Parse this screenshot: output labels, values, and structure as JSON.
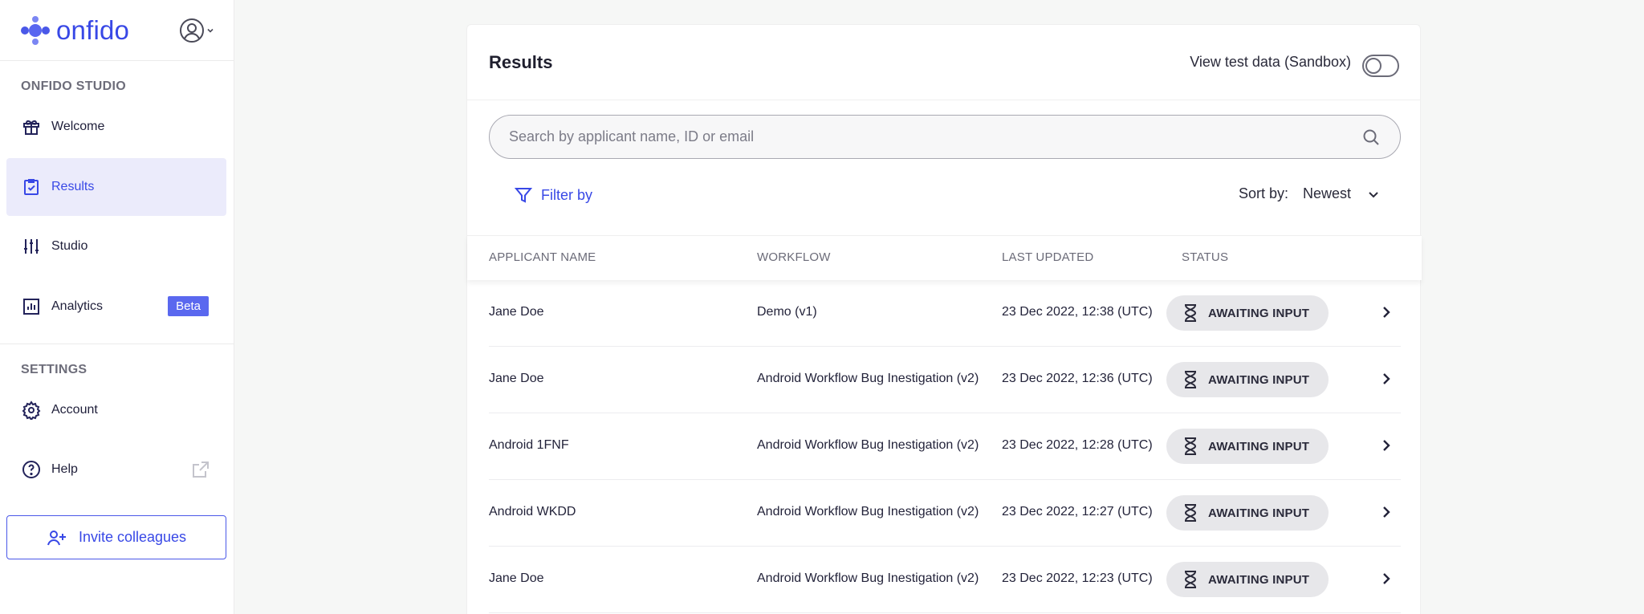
{
  "brand": {
    "name": "onfido"
  },
  "sidebar": {
    "studio_section": "ONFIDO STUDIO",
    "items": [
      {
        "label": "Welcome",
        "icon": "gift-icon"
      },
      {
        "label": "Results",
        "icon": "clipboard-check-icon",
        "active": true
      },
      {
        "label": "Studio",
        "icon": "sliders-icon"
      },
      {
        "label": "Analytics",
        "icon": "bar-chart-icon",
        "badge": "Beta"
      }
    ],
    "settings_section": "SETTINGS",
    "settings_items": [
      {
        "label": "Account",
        "icon": "gear-icon"
      },
      {
        "label": "Help",
        "icon": "help-circle-icon"
      }
    ],
    "invite_label": "Invite colleagues"
  },
  "results": {
    "title": "Results",
    "sandbox_label": "View test data (Sandbox)",
    "sandbox_enabled": false,
    "search_placeholder": "Search by applicant name, ID or email",
    "filter_label": "Filter by",
    "sort_label": "Sort by:",
    "sort_value": "Newest",
    "columns": [
      "APPLICANT NAME",
      "WORKFLOW",
      "LAST UPDATED",
      "STATUS"
    ],
    "rows": [
      {
        "name": "Jane Doe",
        "workflow": "Demo (v1)",
        "updated": "23 Dec 2022, 12:38 (UTC)",
        "status": "AWAITING INPUT"
      },
      {
        "name": "Jane Doe",
        "workflow": "Android Workflow Bug Inestigation (v2)",
        "updated": "23 Dec 2022, 12:36 (UTC)",
        "status": "AWAITING INPUT"
      },
      {
        "name": "Android 1FNF",
        "workflow": "Android Workflow Bug Inestigation (v2)",
        "updated": "23 Dec 2022, 12:28 (UTC)",
        "status": "AWAITING INPUT"
      },
      {
        "name": "Android WKDD",
        "workflow": "Android Workflow Bug Inestigation (v2)",
        "updated": "23 Dec 2022, 12:27 (UTC)",
        "status": "AWAITING INPUT"
      },
      {
        "name": "Jane Doe",
        "workflow": "Android Workflow Bug Inestigation (v2)",
        "updated": "23 Dec 2022, 12:23 (UTC)",
        "status": "AWAITING INPUT"
      }
    ]
  },
  "colors": {
    "accent": "#3848e6",
    "active_bg": "#ebebfb",
    "badge": "#5a68ef",
    "pill_bg": "#e7e7ea"
  }
}
